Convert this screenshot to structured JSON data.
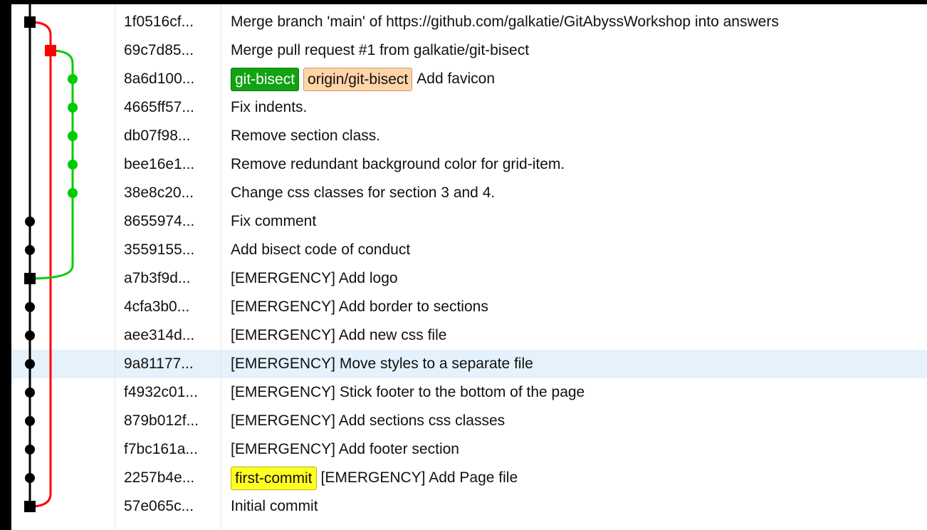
{
  "graph": {
    "colors": {
      "main": "#000000",
      "merge": "#ff0000",
      "branch": "#00cc00"
    },
    "lanes": {
      "main": [
        0,
        1,
        7,
        8,
        9,
        10,
        11,
        12,
        13,
        14,
        15,
        16,
        17
      ],
      "merge": [
        1
      ],
      "branch": [
        2,
        3,
        4,
        5,
        6
      ]
    }
  },
  "commits": [
    {
      "sha": "1f0516cf...",
      "refs": [],
      "message": "Merge branch 'main' of https://github.com/galkatie/GitAbyssWorkshop into answers"
    },
    {
      "sha": "69c7d85...",
      "refs": [],
      "message": "Merge pull request #1 from galkatie/git-bisect"
    },
    {
      "sha": "8a6d100...",
      "refs": [
        {
          "label": "git-bisect",
          "kind": "local"
        },
        {
          "label": "origin/git-bisect",
          "kind": "remote"
        }
      ],
      "message": "Add favicon"
    },
    {
      "sha": "4665ff57...",
      "refs": [],
      "message": "Fix indents."
    },
    {
      "sha": "db07f98...",
      "refs": [],
      "message": "Remove section class."
    },
    {
      "sha": "bee16e1...",
      "refs": [],
      "message": "Remove redundant background color for grid-item."
    },
    {
      "sha": "38e8c20...",
      "refs": [],
      "message": "Change css classes for section 3 and 4."
    },
    {
      "sha": "8655974...",
      "refs": [],
      "message": "Fix comment"
    },
    {
      "sha": "3559155...",
      "refs": [],
      "message": "Add bisect code of conduct"
    },
    {
      "sha": "a7b3f9d...",
      "refs": [],
      "message": "[EMERGENCY] Add logo"
    },
    {
      "sha": "4cfa3b0...",
      "refs": [],
      "message": "[EMERGENCY] Add border to sections"
    },
    {
      "sha": "aee314d...",
      "refs": [],
      "message": "[EMERGENCY] Add new css file"
    },
    {
      "sha": "9a81177...",
      "refs": [],
      "message": "[EMERGENCY] Move styles to a separate file",
      "selected": true
    },
    {
      "sha": "f4932c01...",
      "refs": [],
      "message": "[EMERGENCY] Stick footer to the bottom of the page"
    },
    {
      "sha": "879b012f...",
      "refs": [],
      "message": "[EMERGENCY] Add sections css classes"
    },
    {
      "sha": "f7bc161a...",
      "refs": [],
      "message": "[EMERGENCY] Add footer section"
    },
    {
      "sha": "2257b4e...",
      "refs": [
        {
          "label": "first-commit",
          "kind": "plain"
        }
      ],
      "message": "[EMERGENCY] Add Page file"
    },
    {
      "sha": "57e065c...",
      "refs": [],
      "message": "Initial commit"
    }
  ]
}
